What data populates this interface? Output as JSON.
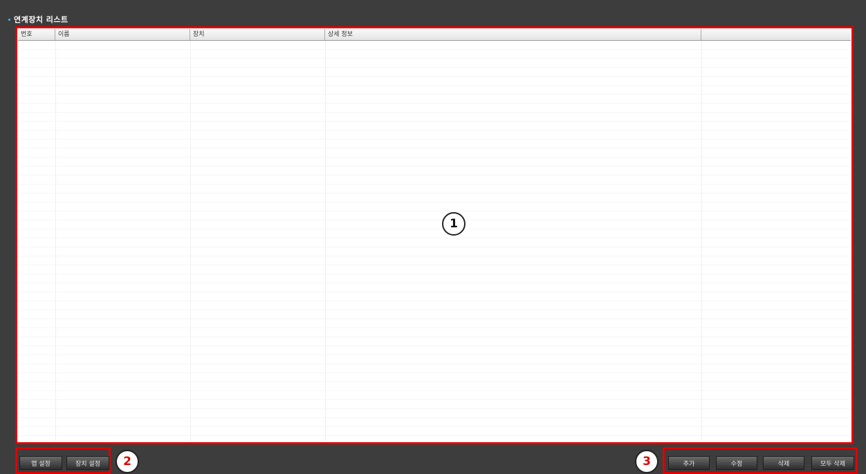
{
  "panel": {
    "title": "연계장치 리스트"
  },
  "table": {
    "columns": [
      "번호",
      "이름",
      "장치",
      "상세 정보",
      ""
    ],
    "rows": []
  },
  "left_buttons": {
    "map_settings": "맵 설정",
    "device_settings": "장치 설정"
  },
  "right_buttons": {
    "add": "추가",
    "edit": "수정",
    "delete": "삭제",
    "delete_all": "모두 삭제"
  },
  "callouts": {
    "c1": "1",
    "c2": "2",
    "c3": "3"
  },
  "colors": {
    "highlight": "#e00000",
    "background": "#3d3d3d",
    "accent_dot": "#4a9fe0"
  }
}
